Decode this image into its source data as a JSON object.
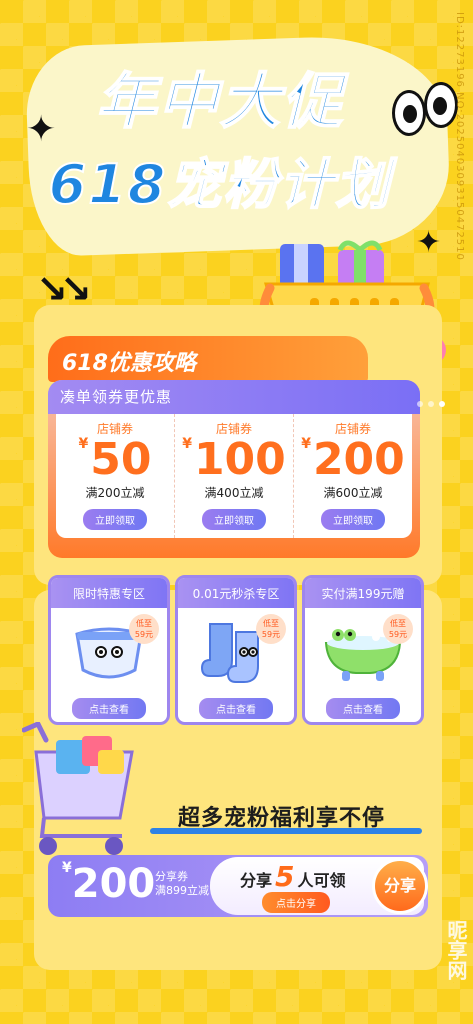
{
  "header": {
    "title_line1": "年中大促",
    "title_line2": "618宠粉计划"
  },
  "watermark": {
    "vertical_id": "ID:12273196 NO:20250403093150472510",
    "brand": "昵享网"
  },
  "strategy": {
    "tag": "618优惠攻略",
    "subtitle": "凑单领券更优惠",
    "coupons": [
      {
        "label": "店铺券",
        "currency": "¥",
        "amount": "50",
        "desc": "满200立减",
        "btn": "立即领取"
      },
      {
        "label": "店铺券",
        "currency": "¥",
        "amount": "100",
        "desc": "满400立减",
        "btn": "立即领取"
      },
      {
        "label": "店铺券",
        "currency": "¥",
        "amount": "200",
        "desc": "满600立减",
        "btn": "立即领取"
      }
    ]
  },
  "zones": [
    {
      "title": "限时特惠专区",
      "badge": "低至\n59元",
      "btn": "点击查看",
      "icon": "diaper-icon"
    },
    {
      "title": "0.01元秒杀专区",
      "badge": "低至\n59元",
      "btn": "点击查看",
      "icon": "baby-socks-icon"
    },
    {
      "title": "实付满199元赠",
      "badge": "低至\n59元",
      "btn": "点击查看",
      "icon": "bathtub-icon"
    }
  ],
  "slogan": "超多宠粉福利享不停",
  "share": {
    "currency": "¥",
    "amount": "200",
    "label1": "分享券",
    "label2": "满899立减",
    "text_prefix": "分享",
    "count": "5",
    "text_suffix": "人可领",
    "btn": "点击分享",
    "circle": "分享"
  },
  "colors": {
    "bg": "#fbd21f",
    "title": "#1f86e0",
    "accent": "#ff6f1e",
    "purple": "#8d7df3"
  }
}
